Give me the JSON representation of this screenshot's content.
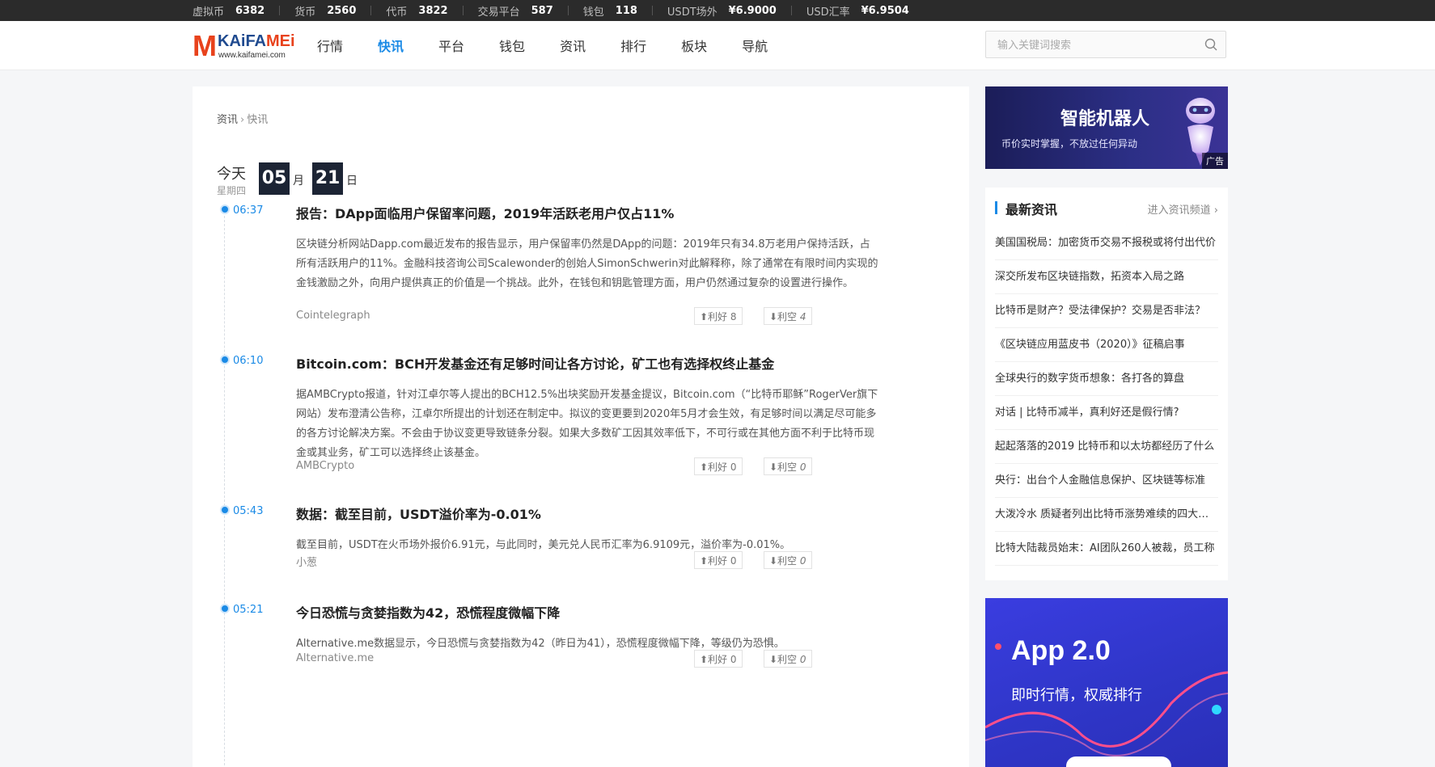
{
  "ticker": [
    {
      "label": "虚拟币",
      "value": "6382"
    },
    {
      "label": "货币",
      "value": "2560"
    },
    {
      "label": "代币",
      "value": "3822"
    },
    {
      "label": "交易平台",
      "value": "587"
    },
    {
      "label": "钱包",
      "value": "118"
    },
    {
      "label": "USDT场外",
      "value": "¥6.9000"
    },
    {
      "label": "USD汇率",
      "value": "¥6.9504"
    }
  ],
  "logo": {
    "m": "M",
    "brand_a": "KAiFA",
    "brand_b": "MEi",
    "url": "www.kaifamei.com"
  },
  "nav": [
    "行情",
    "快讯",
    "平台",
    "钱包",
    "资讯",
    "排行",
    "板块",
    "导航"
  ],
  "nav_active_index": 1,
  "search": {
    "placeholder": "输入关键词搜索"
  },
  "breadcrumb": {
    "parent": "资讯",
    "sep": "›",
    "current": "快讯"
  },
  "date": {
    "today": "今天",
    "weekday": "星期四",
    "month": "05",
    "month_unit": "月",
    "day": "21",
    "day_unit": "日"
  },
  "news": [
    {
      "time": "06:37",
      "title": "报告：DApp面临用户保留率问题，2019年活跃老用户仅占11%",
      "body": "区块链分析网站Dapp.com最近发布的报告显示，用户保留率仍然是DApp的问题：2019年只有34.8万老用户保持活跃，占所有活跃用户的11%。金融科技咨询公司Scalewonder的创始人SimonSchwerin对此解释称，除了通常在有限时间内实现的金钱激励之外，向用户提供真正的价值是一个挑战。此外，在钱包和钥匙管理方面，用户仍然通过复杂的设置进行操作。",
      "source": "Cointelegraph",
      "bull_label": "⬆利好",
      "bull": "8",
      "bear_label": "⬇利空",
      "bear": "4"
    },
    {
      "time": "06:10",
      "title": "Bitcoin.com：BCH开发基金还有足够时间让各方讨论，矿工也有选择权终止基金",
      "body": "据AMBCrypto报道，针对江卓尔等人提出的BCH12.5%出块奖励开发基金提议，Bitcoin.com（“比特币耶稣”RogerVer旗下网站）发布澄清公告称，江卓尔所提出的计划还在制定中。拟议的变更要到2020年5月才会生效，有足够时间以满足尽可能多的各方讨论解决方案。不会由于协议变更导致链条分裂。如果大多数矿工因其效率低下，不可行或在其他方面不利于比特币现金或其业务，矿工可以选择终止该基金。",
      "source": "AMBCrypto",
      "bull_label": "⬆利好",
      "bull": "0",
      "bear_label": "⬇利空",
      "bear": "0"
    },
    {
      "time": "05:43",
      "title": "数据：截至目前，USDT溢价率为-0.01%",
      "body": "截至目前，USDT在火币场外报价6.91元，与此同时，美元兑人民币汇率为6.9109元，溢价率为-0.01%。",
      "source": "小葱",
      "bull_label": "⬆利好",
      "bull": "0",
      "bear_label": "⬇利空",
      "bear": "0"
    },
    {
      "time": "05:21",
      "title": "今日恐慌与贪婪指数为42，恐慌程度微幅下降",
      "body": "Alternative.me数据显示，今日恐慌与贪婪指数为42（昨日为41），恐慌程度微幅下降，等级仍为恐惧。",
      "source": "Alternative.me",
      "bull_label": "⬆利好",
      "bull": "0",
      "bear_label": "⬇利空",
      "bear": "0"
    }
  ],
  "ad_robot": {
    "title": "智能机器人",
    "subtitle": "币价实时掌握，不放过任何异动",
    "tag": "广告"
  },
  "latest": {
    "title": "最新资讯",
    "more": "进入资讯频道 ›",
    "items": [
      "美国国税局：加密货币交易不报税或将付出代价",
      "深交所发布区块链指数，拓资本入局之路",
      "比特币是财产？受法律保护？交易是否非法？",
      "《区块链应用蓝皮书（2020）》征稿启事",
      "全球央行的数字货币想象：各打各的算盘",
      "对话 | 比特币减半，真利好还是假行情?",
      "起起落落的2019 比特币和以太坊都经历了什么",
      "央行：出台个人金融信息保护、区块链等标准",
      "大泼冷水 质疑者列出比特币涨势难续的四大理由",
      "比特大陆裁员始末：AI团队260人被裁，员工称"
    ]
  },
  "ad_app": {
    "title": "App 2.0",
    "subtitle": "即时行情，权威排行"
  },
  "colors": {
    "accent": "#1a8ae6",
    "logo_red": "#e8421c",
    "logo_blue": "#1f4a8f",
    "date_box": "#1c2434"
  }
}
